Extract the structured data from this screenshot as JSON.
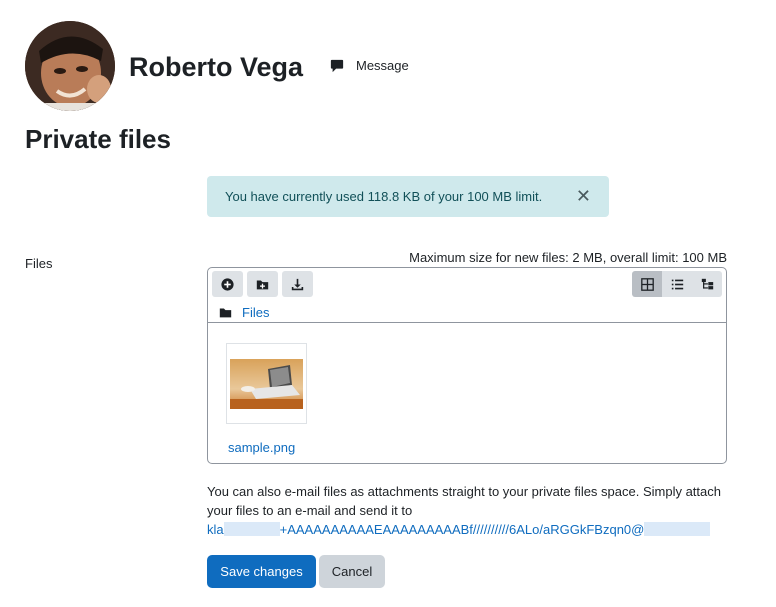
{
  "profile": {
    "name": "Roberto Vega",
    "message_label": "Message"
  },
  "page": {
    "title": "Private files"
  },
  "alert": {
    "text": "You have currently used 118.8 KB of your 100 MB limit.",
    "close_glyph": "✕"
  },
  "form": {
    "files_label": "Files",
    "max_size_text": "Maximum size for new files: 2 MB, overall limit: 100 MB"
  },
  "filemanager": {
    "breadcrumb_root": "Files",
    "files": [
      {
        "name": "sample.png"
      }
    ]
  },
  "email": {
    "intro": "You can also e-mail files as attachments straight to your private files space. Simply attach your files to an e-mail and send it to",
    "address_prefix": "kla",
    "address_middle": "+AAAAAAAAAAEAAAAAAAAABf//////////6ALo/aRGGkFBzqn0@"
  },
  "buttons": {
    "save": "Save changes",
    "cancel": "Cancel"
  },
  "colors": {
    "primary": "#0f6cbf",
    "alert_bg": "#cfe9ec",
    "alert_text": "#115058",
    "secondary_btn": "#ced4da"
  }
}
